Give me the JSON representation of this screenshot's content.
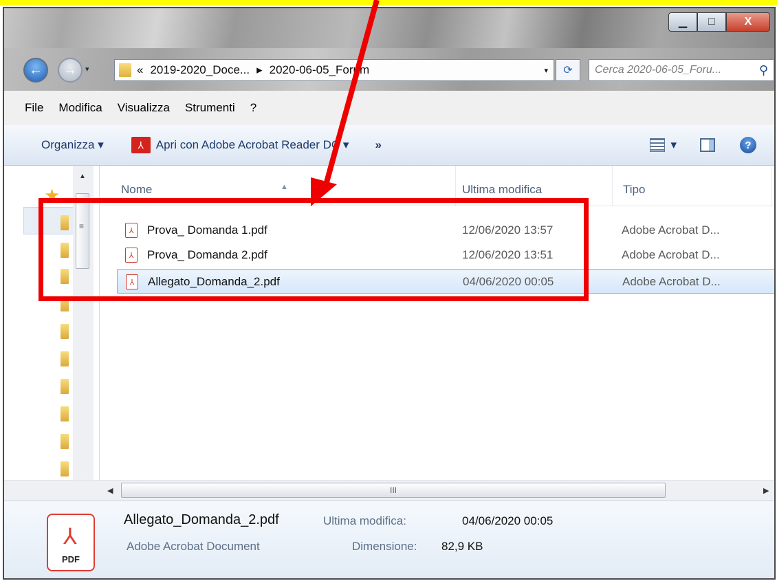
{
  "window": {
    "controls": {
      "minimize": "▁",
      "maximize": "□",
      "close": "X"
    }
  },
  "address": {
    "overflow": "«",
    "segments": [
      "2019-2020_Doce...",
      "2020-06-05_Forum"
    ],
    "separator": "▸",
    "dropdown": "▾",
    "refresh": "⟳",
    "search_placeholder": "Cerca 2020-06-05_Foru..."
  },
  "nav": {
    "back": "←",
    "forward": "→",
    "history_dropdown": "▾"
  },
  "menubar": {
    "items": [
      "File",
      "Modifica",
      "Visualizza",
      "Strumenti",
      "?"
    ]
  },
  "cmdbar": {
    "organize": "Organizza ▾",
    "open_with": "Apri con Adobe Acrobat Reader DC ▾",
    "more": "»",
    "view_dropdown": "▾",
    "help": "?"
  },
  "columns": {
    "name": "Nome",
    "modified": "Ultima modifica",
    "type": "Tipo",
    "sort_indicator": "▲"
  },
  "files": [
    {
      "name": "Prova_ Domanda 1.pdf",
      "modified": "12/06/2020 13:57",
      "type": "Adobe Acrobat D...",
      "selected": false
    },
    {
      "name": "Prova_ Domanda 2.pdf",
      "modified": "12/06/2020 13:51",
      "type": "Adobe Acrobat D...",
      "selected": false
    },
    {
      "name": "Allegato_Domanda_2.pdf",
      "modified": "04/06/2020 00:05",
      "type": "Adobe Acrobat D...",
      "selected": true
    }
  ],
  "scrollbars": {
    "up": "▲",
    "down": "▼",
    "left": "◀",
    "right": "▶",
    "grip": "III",
    "vgrip": "≡"
  },
  "details": {
    "name": "Allegato_Domanda_2.pdf",
    "modified_label": "Ultima modifica:",
    "modified_value": "04/06/2020 00:05",
    "type": "Adobe Acrobat Document",
    "size_label": "Dimensione:",
    "size_value": "82,9 KB",
    "icon_label": "PDF"
  },
  "colors": {
    "annotation": "#ee0000",
    "selection": "#d6e7fb",
    "highlight_strip": "#ffff00"
  }
}
